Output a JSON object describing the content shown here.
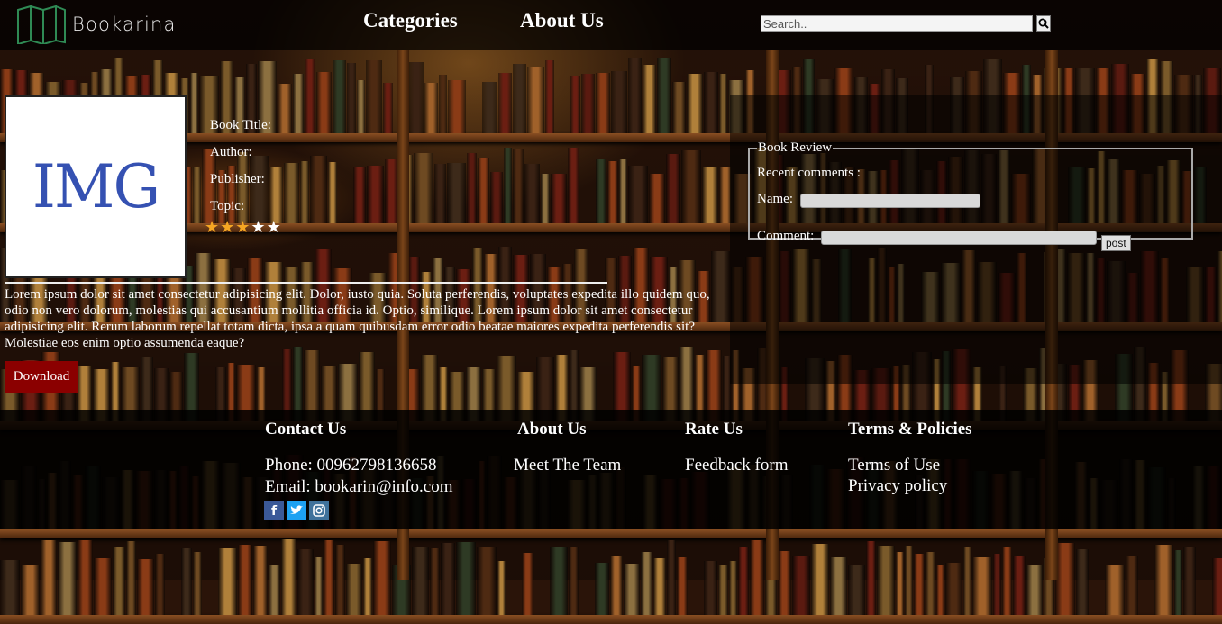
{
  "header": {
    "brand": "Bookarina",
    "nav": {
      "categories": "Categories",
      "about": "About Us"
    },
    "search": {
      "placeholder": "Search.."
    }
  },
  "book": {
    "cover_text": "IMG",
    "title_label": "Book Title:",
    "author_label": "Author:",
    "publisher_label": "Publisher:",
    "topic_label": "Topic:",
    "rating": 3,
    "rating_max": 5,
    "description": "Lorem ipsum dolor sit amet consectetur adipisicing elit. Dolor, iusto quia. Soluta perferendis, voluptates expedita illo quidem quo, odio non vero dolorum, molestias qui accusantium mollitia officia id. Optio, similique. Lorem ipsum dolor sit amet consectetur adipisicing elit. Rerum laborum repellat totam dicta, ipsa a quam quibusdam error odio beatae maiores expedita perferendis sit? Molestiae eos enim optio assumenda eaque?",
    "download_label": "Download"
  },
  "review": {
    "legend": "Book Review",
    "recent_label": "Recent comments :",
    "name_label": "Name:",
    "comment_label": "Comment:",
    "post_label": "post"
  },
  "footer": {
    "contact": {
      "heading": "Contact Us",
      "phone": "Phone: 00962798136658",
      "email": "Email: bookarin@info.com"
    },
    "about": {
      "heading": "About Us",
      "team": "Meet The Team"
    },
    "rate": {
      "heading": "Rate Us",
      "feedback": "Feedback form"
    },
    "terms": {
      "heading": "Terms & Policies",
      "terms_of_use": "Terms of Use",
      "privacy": "Privacy policy"
    },
    "socials": [
      {
        "name": "facebook-icon",
        "color": "#3b5998"
      },
      {
        "name": "twitter-icon",
        "color": "#1da1f2"
      },
      {
        "name": "instagram-icon",
        "color": "#3f729b"
      }
    ]
  },
  "colors": {
    "download_bg": "#8b0000",
    "star_filled": "#f5a623",
    "star_empty": "#ffffff",
    "cover_text": "#3551b2"
  }
}
